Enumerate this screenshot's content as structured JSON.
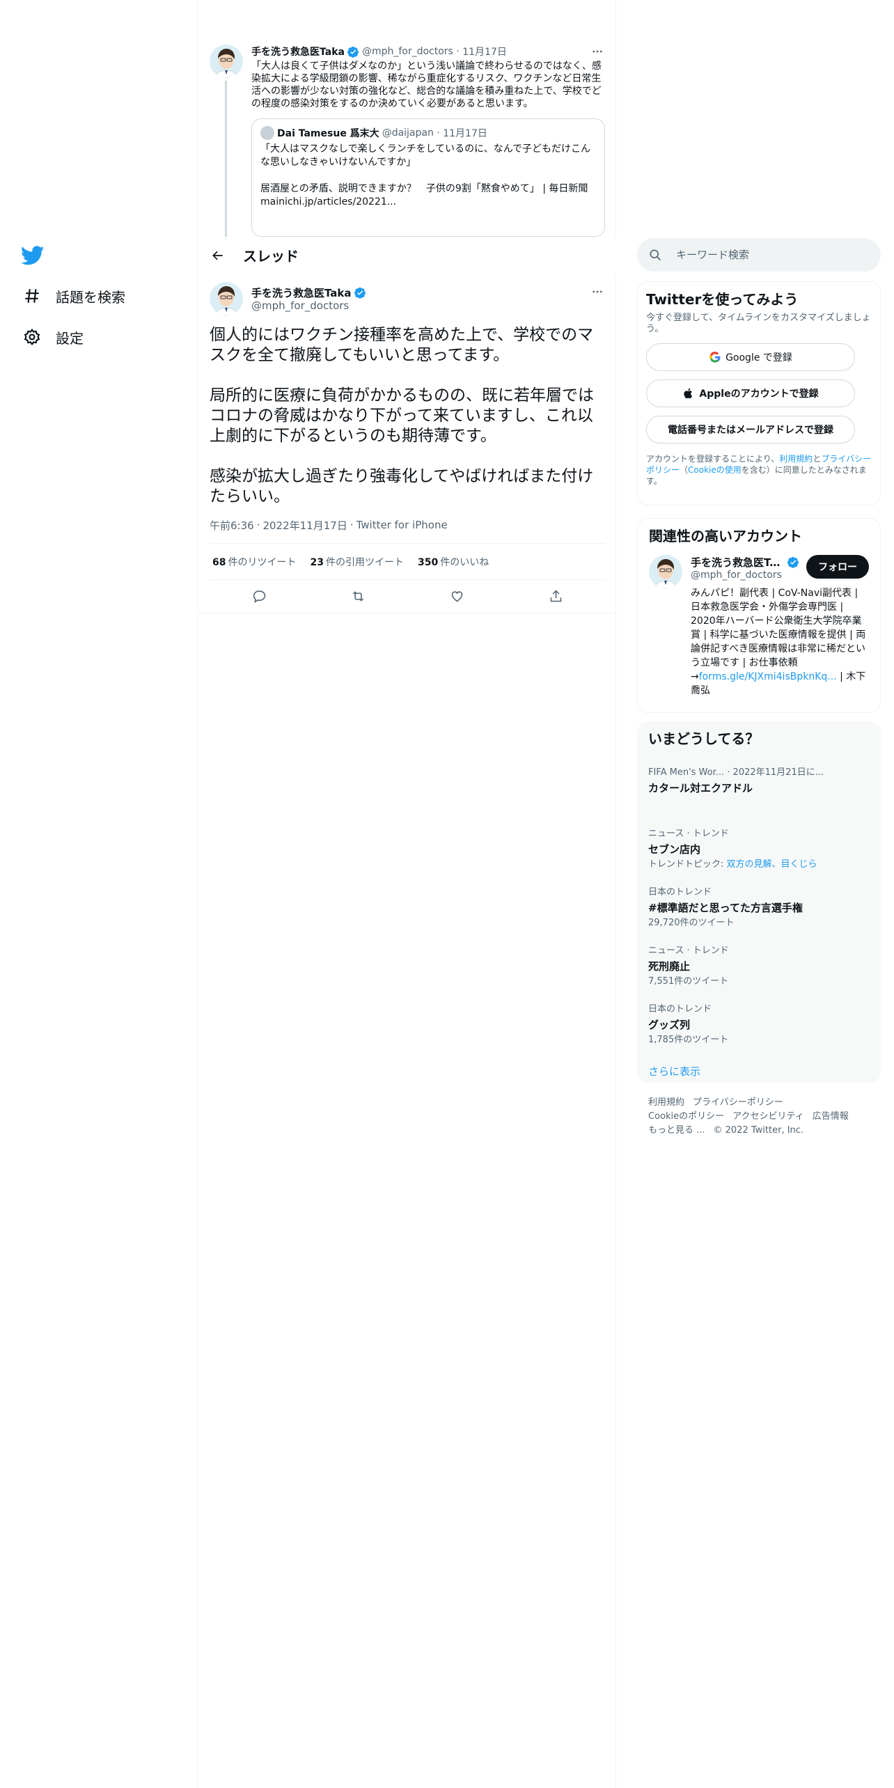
{
  "nav": {
    "explore_label": "話題を検索",
    "settings_label": "設定"
  },
  "context_tweet": {
    "name": "手を洗う救急医Taka",
    "handle": "@mph_for_doctors",
    "date": "11月17日",
    "text": "「大人は良くて子供はダメなのか」という浅い議論で終わらせるのではなく、感染拡大による学級閉鎖の影響、稀ながら重症化するリスク、ワクチンなど日常生活への影響が少ない対策の強化など、総合的な議論を積み重ねた上で、学校でどの程度の感染対策をするのか決めていく必要があると思います。",
    "quote": {
      "name": "Dai Tamesue 爲末大",
      "handle": "@daijapan",
      "date": "11月17日",
      "text": "「大人はマスクなしで楽しくランチをしているのに、なんで子どもだけこんな思いしなきゃいけないんですか」\n\n居酒屋との矛盾、説明できますか？　子供の9割「黙食やめて」 | 毎日新聞 mainichi.jp/articles/20221..."
    }
  },
  "topbar": {
    "title": "スレッド"
  },
  "focal_tweet": {
    "name": "手を洗う救急医Taka",
    "handle": "@mph_for_doctors",
    "text": "個人的にはワクチン接種率を高めた上で、学校でのマスクを全て撤廃してもいいと思ってます。\n\n局所的に医療に負荷がかかるものの、既に若年層ではコロナの脅威はかなり下がって来ていますし、これ以上劇的に下がるというのも期待薄です。\n\n感染が拡大し過ぎたり強毒化してやばければまた付けたらいい。",
    "time": "午前6:36",
    "date": "2022年11月17日",
    "source": "Twitter for iPhone",
    "retweets": "68",
    "retweets_label": "件のリツイート",
    "quotes": "23",
    "quotes_label": "件の引用ツイート",
    "likes": "350",
    "likes_label": "件のいいね"
  },
  "search": {
    "placeholder": "キーワード検索"
  },
  "signup": {
    "title": "Twitterを使ってみよう",
    "subtitle": "今すぐ登録して、タイムラインをカスタマイズしましょう。",
    "google_label": "Google で登録",
    "apple_label": "Appleのアカウントで登録",
    "phone_label": "電話番号またはメールアドレスで登録",
    "legal_pre": "アカウントを登録することにより、",
    "legal_terms": "利用規約",
    "legal_and": "と",
    "legal_privacy": "プライバシーポリシー",
    "legal_open": "（",
    "legal_cookie": "Cookieの使用",
    "legal_post": "を含む）に同意したとみなされます。"
  },
  "related": {
    "title": "関連性の高いアカウント",
    "name": "手を洗う救急医Ta...",
    "handle": "@mph_for_doctors",
    "follow_label": "フォロー",
    "bio": "みんパピ！副代表 | CoV-Navi副代表 | 日本救急医学会・外傷学会専門医 | 2020年ハーバード公衆衛生大学院卒業賞 | 科学に基づいた医療情報を提供 | 両論併記すべき医療情報は非常に稀だという立場です | お仕事依頼→",
    "bio_link": "forms.gle/KJXmi4isBpknKq...",
    "bio_tail": " | 木下喬弘"
  },
  "trends": {
    "title": "いまどうしてる？",
    "items": [
      {
        "context": "FIFA Men's Wor... · 2022年11月21日に...",
        "title": "カタール対エクアドル",
        "count": ""
      },
      {
        "context": "ニュース · トレンド",
        "title": "セブン店内",
        "count_pre": "トレンドトピック: ",
        "count_link": "双方の見解、目くじら"
      },
      {
        "context": "日本のトレンド",
        "title": "#標準語だと思ってた方言選手権",
        "count": "29,720件のツイート"
      },
      {
        "context": "ニュース · トレンド",
        "title": "死刑廃止",
        "count": "7,551件のツイート"
      },
      {
        "context": "日本のトレンド",
        "title": "グッズ列",
        "count": "1,785件のツイート"
      }
    ],
    "show_more": "さらに表示"
  },
  "footer": {
    "terms": "利用規約",
    "privacy": "プライバシーポリシー",
    "cookie": "Cookieのポリシー",
    "accessibility": "アクセシビリティ",
    "ads": "広告情報",
    "more": "もっと見る ...",
    "copyright": "© 2022 Twitter, Inc."
  },
  "colors": {
    "accent": "#1d9bf0",
    "text": "#0f1419",
    "muted": "#536471",
    "border": "#eff3f4"
  }
}
